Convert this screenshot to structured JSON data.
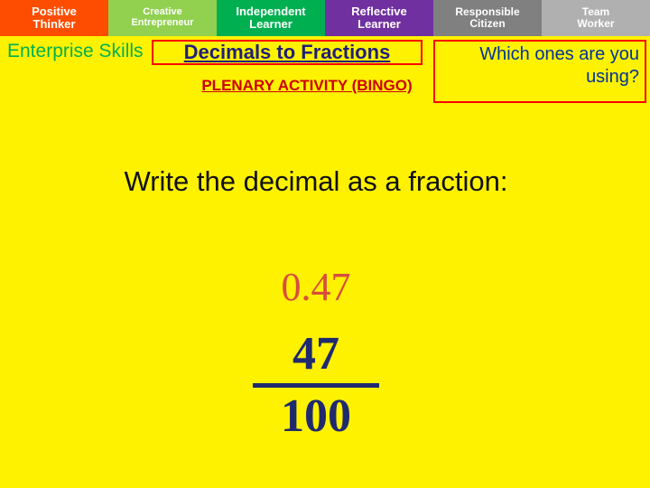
{
  "skills_bar": {
    "items": [
      {
        "line1": "Positive",
        "line2": "Thinker"
      },
      {
        "line1": "Creative",
        "line2": "Entrepreneur"
      },
      {
        "line1": "Independent",
        "line2": "Learner"
      },
      {
        "line1": "Reflective",
        "line2": "Learner"
      },
      {
        "line1": "Responsible",
        "line2": "Citizen"
      },
      {
        "line1": "Team",
        "line2": "Worker"
      }
    ],
    "colors": [
      "#FF4D00",
      "#92D050",
      "#00B050",
      "#7030A0",
      "#808080",
      "#B0B0B0"
    ]
  },
  "header": {
    "enterprise_label": "Enterprise Skills",
    "title": "Decimals to Fractions",
    "question": "Which ones are you using?",
    "subtitle": "PLENARY ACTIVITY (BINGO)"
  },
  "main": {
    "prompt": "Write the decimal as a fraction:",
    "decimal": "0.47",
    "fraction": {
      "numerator": "47",
      "denominator": "100"
    }
  },
  "theme": {
    "background": "#FFF200",
    "title_color": "#1F1F7A",
    "decimal_color": "#D94C3D",
    "fraction_color": "#1F2A6E",
    "subtitle_color": "#CC0000",
    "border_color": "#FF0000",
    "enterprise_color": "#00B050",
    "question_color": "#003399"
  }
}
